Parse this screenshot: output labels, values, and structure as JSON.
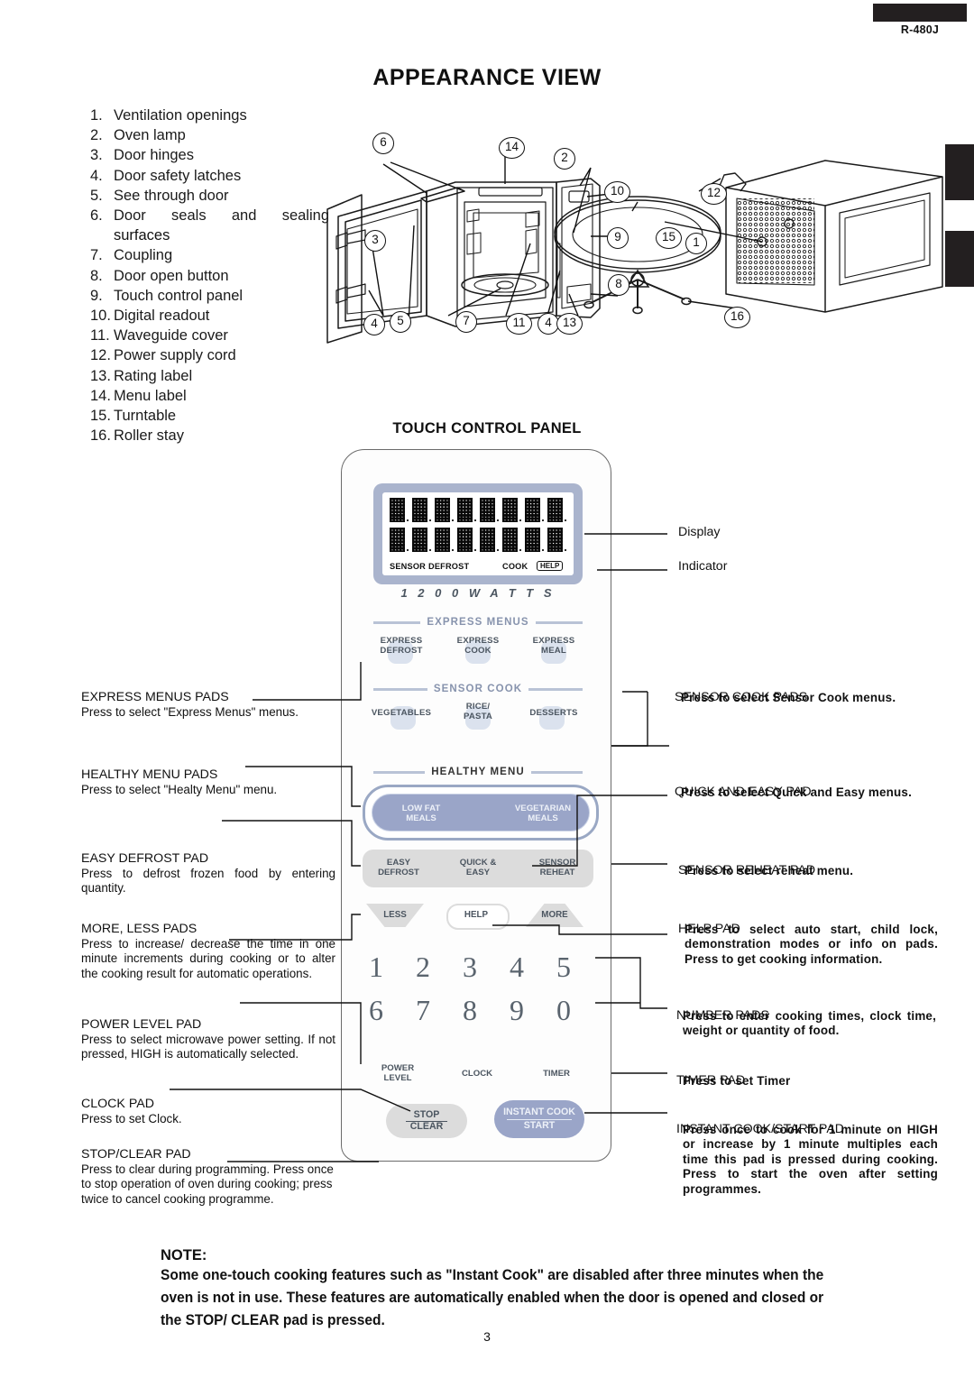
{
  "header": {
    "model": "R-480J"
  },
  "title": "APPEARANCE VIEW",
  "parts": [
    {
      "num": "1.",
      "label": "Ventilation openings"
    },
    {
      "num": "2.",
      "label": "Oven lamp"
    },
    {
      "num": "3.",
      "label": "Door hinges"
    },
    {
      "num": "4.",
      "label": "Door safety latches"
    },
    {
      "num": "5.",
      "label": "See through door"
    },
    {
      "num": "6.",
      "label": "Door seals and sealing",
      "cont": "surfaces"
    },
    {
      "num": "7.",
      "label": "Coupling"
    },
    {
      "num": "8.",
      "label": "Door open button"
    },
    {
      "num": "9.",
      "label": "Touch control panel"
    },
    {
      "num": "10.",
      "label": "Digital readout"
    },
    {
      "num": "11.",
      "label": "Waveguide cover"
    },
    {
      "num": "12.",
      "label": "Power supply cord"
    },
    {
      "num": "13.",
      "label": "Rating label"
    },
    {
      "num": "14.",
      "label": "Menu label"
    },
    {
      "num": "15.",
      "label": "Turntable"
    },
    {
      "num": "16.",
      "label": "Roller stay"
    }
  ],
  "callouts": {
    "c1": "1",
    "c2": "2",
    "c3": "3",
    "c4a": "4",
    "c4b": "4",
    "c4c": "4",
    "c5": "5",
    "c6": "6",
    "c7": "7",
    "c8": "8",
    "c9": "9",
    "c10": "10",
    "c11": "11",
    "c12": "12",
    "c13": "13",
    "c14": "14",
    "c15": "15",
    "c16": "16"
  },
  "panel": {
    "heading": "TOUCH CONTROL PANEL",
    "watts": "1 2 0 0   W A T T S",
    "indicators": {
      "sensor": "SENSOR",
      "defrost": "DEFROST",
      "cook": "COOK",
      "help": "HELP"
    },
    "express_section": "EXPRESS MENUS",
    "express_pads": [
      {
        "l1": "EXPRESS",
        "l2": "DEFROST"
      },
      {
        "l1": "EXPRESS",
        "l2": "COOK"
      },
      {
        "l1": "EXPRESS",
        "l2": "MEAL"
      }
    ],
    "sensor_section": "SENSOR COOK",
    "sensor_pads": [
      {
        "l1": "VEGETABLES",
        "l2": ""
      },
      {
        "l1": "RICE/",
        "l2": "PASTA"
      },
      {
        "l1": "DESSERTS",
        "l2": ""
      }
    ],
    "healthy_section": "HEALTHY MENU",
    "healthy_pads": [
      {
        "l1": "LOW FAT",
        "l2": "MEALS"
      },
      {
        "l1": "VEGETARIAN",
        "l2": "MEALS"
      }
    ],
    "grey_pads": [
      {
        "l1": "EASY",
        "l2": "DEFROST"
      },
      {
        "l1": "QUICK &",
        "l2": "EASY"
      },
      {
        "l1": "SENSOR",
        "l2": "REHEAT"
      }
    ],
    "less": "LESS",
    "help": "HELP",
    "more": "MORE",
    "numbers_row1": [
      "1",
      "2",
      "3",
      "4",
      "5"
    ],
    "numbers_row2": [
      "6",
      "7",
      "8",
      "9",
      "0"
    ],
    "power_level_l1": "POWER",
    "power_level_l2": "LEVEL",
    "clock": "CLOCK",
    "timer": "TIMER",
    "stop_l1": "STOP",
    "stop_l2": "CLEAR",
    "start_l1": "INSTANT COOK",
    "start_l2": "START"
  },
  "annotations_right": {
    "display": "Display",
    "indicator": "Indicator",
    "sensor_cook": {
      "head": "SENSOR COOK PADS",
      "body": "Press to select Sensor Cook menus."
    },
    "quick_easy": {
      "head": "QUICK AND EASY PAD",
      "body": "Press to select Quick and Easy menus."
    },
    "sensor_reheat": {
      "head": "SENSOR REHEAT PAD",
      "body": "Press to select reheat menu."
    },
    "help": {
      "head": "HELP PAD",
      "body": "Press to select auto start, child lock, demonstration modes or info on pads. Press to get cooking information."
    },
    "numbers": {
      "head": "NUMBER PADS",
      "body": "Press to enter cooking times, clock time, weight or quantity of food."
    },
    "timer": {
      "head": "TIMER PAD",
      "body": "Press to set Timer"
    },
    "instant": {
      "head": "INSTANT COOK/START PAD",
      "body": "Press once to cook for 1 minute on HIGH or increase by 1 minute multiples each time this pad is pressed during cooking. Press to start the oven after setting programmes."
    }
  },
  "annotations_left": {
    "express": {
      "head": "EXPRESS MENUS PADS",
      "body": "Press to select \"Express Menus\" menus."
    },
    "healthy": {
      "head": "HEALTHY MENU PADS",
      "body": "Press to select \"Healty Menu\" menu."
    },
    "easy_defrost": {
      "head": "EASY DEFROST PAD",
      "body": "Press to defrost frozen food by entering quantity."
    },
    "more_less": {
      "head": "MORE, LESS PADS",
      "body": "Press to increase/ decrease the time in one minute increments during cooking or to alter the cooking result for automatic operations."
    },
    "power_level": {
      "head": "POWER LEVEL PAD",
      "body": "Press to select microwave power setting. If not pressed, HIGH is automatically selected."
    },
    "clock": {
      "head": "CLOCK PAD",
      "body": "Press to set Clock."
    },
    "stop_clear": {
      "head": "STOP/CLEAR PAD",
      "body": "Press to clear during programming. Press once to stop operation of oven during cooking; press twice to cancel cooking programme."
    }
  },
  "note": {
    "head": "NOTE:",
    "line1": "Some one-touch cooking features such as \"Instant Cook\" are disabled after three minutes when the",
    "line2": "oven is not in use. These features are automatically enabled when the door is opened and closed or",
    "line3": "the STOP/ CLEAR pad is pressed."
  },
  "page_number": "3"
}
